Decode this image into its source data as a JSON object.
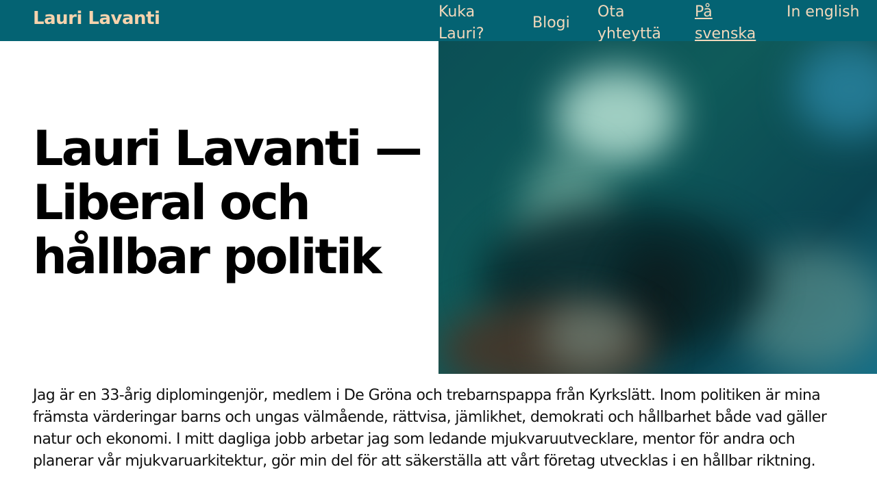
{
  "site": {
    "brand": "Lauri Lavanti"
  },
  "nav": {
    "items": [
      {
        "label": "Kuka Lauri?"
      },
      {
        "label": "Blogi"
      },
      {
        "label": "Ota yhteyttä"
      },
      {
        "label": "På svenska"
      },
      {
        "label": "In english"
      }
    ]
  },
  "hero": {
    "headline": "Lauri Lavanti — Liberal och hållbar politik",
    "image": "portrait-photo-blurred"
  },
  "intro": {
    "text": "Jag är en 33-årig diplomingenjör, medlem i De Gröna och trebarnspappa från Kyrkslätt. Inom politiken är mina främsta värderingar barns och ungas välmående, rättvisa, jämlikhet, demokrati och hållbarhet både vad gäller natur och ekonomi. I mitt dagliga jobb arbetar jag som ledande mjukvaruutvecklare, mentor för andra och planerar vår mjukvaruarkitektur, gör min del för att säkerställa att vårt företag utvecklas i en hållbar riktning."
  },
  "colors": {
    "header_bg": "#046373",
    "brand_text": "#f6d3ad",
    "nav_text": "#f1d8bb"
  }
}
